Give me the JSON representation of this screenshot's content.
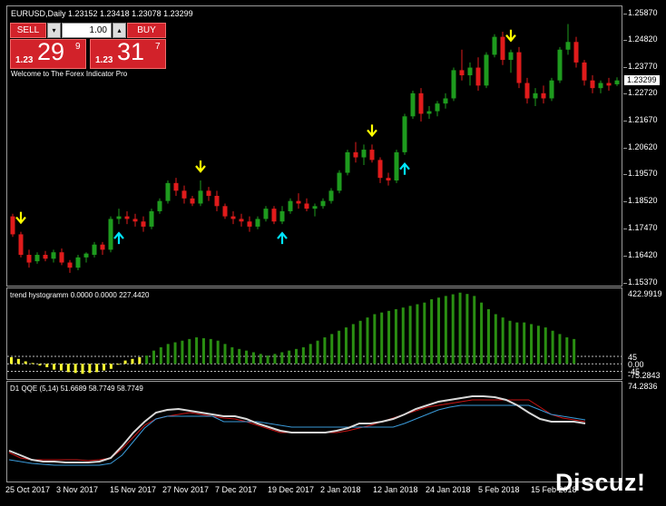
{
  "chart_header": {
    "symbol_line": "EURUSD,Daily  1.23152 1.23418 1.23078 1.23299",
    "welcome": "Welcome to The Forex Indicator Pro"
  },
  "trade_panel": {
    "sell_label": "SELL",
    "buy_label": "BUY",
    "lot_value": "1.00",
    "sell_prefix": "1.23",
    "sell_main": "29",
    "sell_sup": "9",
    "buy_prefix": "1.23",
    "buy_main": "31",
    "buy_sup": "7",
    "down_glyph": "▾",
    "up_glyph": "▴"
  },
  "price_scale": {
    "labels": [
      "1.25870",
      "1.24820",
      "1.23770",
      "1.22720",
      "1.21670",
      "1.20620",
      "1.19570",
      "1.18520",
      "1.17470",
      "1.16420",
      "1.15370"
    ],
    "current": "1.23299"
  },
  "histogram_pane": {
    "title": "trend hystogramm 0.0000 0.0000 227.4420",
    "scale_labels": [
      "422.9919",
      "45",
      "0.00",
      "-45",
      "-75.2843"
    ]
  },
  "qqe_pane": {
    "title": "D1  QQE (5,14) 51.6689 58.7749 58.7749",
    "scale_labels": [
      "74.2836"
    ]
  },
  "time_axis": {
    "labels": [
      "25 Oct 2017",
      "3 Nov 2017",
      "15 Nov 2017",
      "27 Nov 2017",
      "7 Dec 2017",
      "19 Dec 2017",
      "2 Jan 2018",
      "12 Jan 2018",
      "24 Jan 2018",
      "5 Feb 2018",
      "15 Feb 2018"
    ]
  },
  "watermark": "Discuz!",
  "colors": {
    "bull": "#1e9b1e",
    "bear": "#e01b1b",
    "sell_arrow": "#ffff00",
    "buy_arrow": "#00e5ff",
    "hist_up": "#2a8f12",
    "hist_neutral": "#ffff33",
    "qqe_fast": "#d9d9d9",
    "qqe_slow": "#3a9ad9",
    "qqe_signal": "#c81414"
  },
  "chart_data": [
    {
      "type": "candlestick",
      "title": "EURUSD,Daily",
      "ylim": [
        1.1537,
        1.2587
      ],
      "candles": [
        [
          1.18,
          1.181,
          1.172,
          1.173
        ],
        [
          1.173,
          1.174,
          1.164,
          1.165
        ],
        [
          1.165,
          1.167,
          1.16,
          1.162
        ],
        [
          1.1625,
          1.166,
          1.1615,
          1.165
        ],
        [
          1.165,
          1.1665,
          1.1625,
          1.1635
        ],
        [
          1.1635,
          1.167,
          1.162,
          1.166
        ],
        [
          1.166,
          1.1675,
          1.161,
          1.162
        ],
        [
          1.162,
          1.163,
          1.158,
          1.16
        ],
        [
          1.16,
          1.165,
          1.159,
          1.164
        ],
        [
          1.164,
          1.166,
          1.162,
          1.1655
        ],
        [
          1.165,
          1.17,
          1.164,
          1.169
        ],
        [
          1.169,
          1.17,
          1.165,
          1.167
        ],
        [
          1.167,
          1.18,
          1.166,
          1.179
        ],
        [
          1.179,
          1.183,
          1.177,
          1.18
        ],
        [
          1.18,
          1.182,
          1.177,
          1.179
        ],
        [
          1.179,
          1.181,
          1.176,
          1.178
        ],
        [
          1.178,
          1.18,
          1.174,
          1.176
        ],
        [
          1.176,
          1.183,
          1.175,
          1.182
        ],
        [
          1.182,
          1.187,
          1.181,
          1.186
        ],
        [
          1.186,
          1.194,
          1.185,
          1.193
        ],
        [
          1.193,
          1.195,
          1.188,
          1.19
        ],
        [
          1.19,
          1.192,
          1.185,
          1.187
        ],
        [
          1.187,
          1.188,
          1.184,
          1.185
        ],
        [
          1.185,
          1.194,
          1.184,
          1.19
        ],
        [
          1.19,
          1.1915,
          1.186,
          1.188
        ],
        [
          1.188,
          1.19,
          1.182,
          1.184
        ],
        [
          1.184,
          1.185,
          1.179,
          1.18
        ],
        [
          1.18,
          1.182,
          1.177,
          1.179
        ],
        [
          1.179,
          1.181,
          1.176,
          1.178
        ],
        [
          1.178,
          1.18,
          1.174,
          1.176
        ],
        [
          1.176,
          1.18,
          1.175,
          1.179
        ],
        [
          1.179,
          1.184,
          1.178,
          1.183
        ],
        [
          1.183,
          1.184,
          1.177,
          1.178
        ],
        [
          1.178,
          1.184,
          1.177,
          1.182
        ],
        [
          1.182,
          1.187,
          1.181,
          1.186
        ],
        [
          1.186,
          1.189,
          1.183,
          1.185
        ],
        [
          1.185,
          1.187,
          1.182,
          1.183
        ],
        [
          1.183,
          1.185,
          1.18,
          1.184
        ],
        [
          1.184,
          1.187,
          1.183,
          1.186
        ],
        [
          1.186,
          1.191,
          1.185,
          1.19
        ],
        [
          1.19,
          1.198,
          1.189,
          1.197
        ],
        [
          1.197,
          1.206,
          1.196,
          1.205
        ],
        [
          1.205,
          1.209,
          1.201,
          1.203
        ],
        [
          1.203,
          1.208,
          1.2,
          1.206
        ],
        [
          1.206,
          1.208,
          1.201,
          1.202
        ],
        [
          1.202,
          1.203,
          1.193,
          1.195
        ],
        [
          1.195,
          1.197,
          1.192,
          1.194
        ],
        [
          1.194,
          1.206,
          1.193,
          1.205
        ],
        [
          1.205,
          1.22,
          1.204,
          1.219
        ],
        [
          1.219,
          1.229,
          1.218,
          1.228
        ],
        [
          1.228,
          1.23,
          1.217,
          1.22
        ],
        [
          1.22,
          1.223,
          1.218,
          1.221
        ],
        [
          1.221,
          1.225,
          1.219,
          1.224
        ],
        [
          1.224,
          1.228,
          1.222,
          1.226
        ],
        [
          1.226,
          1.238,
          1.225,
          1.237
        ],
        [
          1.237,
          1.245,
          1.233,
          1.235
        ],
        [
          1.235,
          1.24,
          1.231,
          1.238
        ],
        [
          1.238,
          1.242,
          1.229,
          1.231
        ],
        [
          1.231,
          1.244,
          1.23,
          1.243
        ],
        [
          1.243,
          1.251,
          1.242,
          1.25
        ],
        [
          1.25,
          1.252,
          1.239,
          1.241
        ],
        [
          1.241,
          1.245,
          1.236,
          1.244
        ],
        [
          1.244,
          1.246,
          1.23,
          1.232
        ],
        [
          1.232,
          1.234,
          1.224,
          1.226
        ],
        [
          1.226,
          1.23,
          1.223,
          1.228
        ],
        [
          1.228,
          1.231,
          1.224,
          1.226
        ],
        [
          1.226,
          1.234,
          1.225,
          1.233
        ],
        [
          1.233,
          1.246,
          1.232,
          1.245
        ],
        [
          1.245,
          1.255,
          1.243,
          1.248
        ],
        [
          1.248,
          1.25,
          1.238,
          1.24
        ],
        [
          1.24,
          1.241,
          1.231,
          1.233
        ],
        [
          1.233,
          1.235,
          1.228,
          1.23
        ],
        [
          1.23,
          1.233,
          1.228,
          1.232
        ],
        [
          1.232,
          1.234,
          1.229,
          1.231
        ],
        [
          1.2315,
          1.2342,
          1.2308,
          1.233
        ]
      ],
      "signals": [
        {
          "i": 1,
          "dir": "sell"
        },
        {
          "i": 13,
          "dir": "buy"
        },
        {
          "i": 23,
          "dir": "sell"
        },
        {
          "i": 33,
          "dir": "buy"
        },
        {
          "i": 44,
          "dir": "sell"
        },
        {
          "i": 48,
          "dir": "buy"
        },
        {
          "i": 61,
          "dir": "sell"
        }
      ]
    },
    {
      "type": "bar",
      "title": "trend hystogramm",
      "ylim": [
        -75.2843,
        422.9919
      ],
      "levels": [
        45,
        0,
        -45
      ],
      "values": [
        40,
        30,
        15,
        5,
        -10,
        -20,
        -35,
        -40,
        -50,
        -55,
        -60,
        -55,
        -50,
        -40,
        -30,
        0,
        20,
        30,
        40,
        50,
        80,
        100,
        120,
        130,
        140,
        150,
        160,
        155,
        150,
        140,
        120,
        100,
        90,
        80,
        70,
        60,
        50,
        60,
        70,
        80,
        90,
        100,
        120,
        140,
        160,
        180,
        200,
        220,
        240,
        260,
        280,
        300,
        310,
        320,
        330,
        340,
        350,
        360,
        370,
        390,
        400,
        410,
        420,
        430,
        422,
        410,
        370,
        330,
        300,
        280,
        260,
        250,
        250,
        240,
        230,
        220,
        200,
        180,
        160,
        150
      ]
    },
    {
      "type": "line",
      "title": "QQE (5,14)",
      "ylim": [
        0,
        100
      ],
      "series": [
        {
          "values": [
            30,
            25,
            20,
            18,
            18,
            17,
            17,
            17,
            18,
            22,
            35,
            50,
            62,
            72,
            75,
            76,
            74,
            72,
            70,
            68,
            68,
            65,
            60,
            56,
            52,
            50,
            50,
            50,
            50,
            52,
            55,
            60,
            60,
            62,
            65,
            70,
            76,
            80,
            84,
            86,
            88,
            90,
            90,
            89,
            86,
            80,
            72,
            65,
            62,
            62,
            62,
            60
          ]
        },
        {
          "values": [
            20,
            18,
            16,
            15,
            14,
            14,
            14,
            14,
            14,
            16,
            25,
            40,
            55,
            65,
            68,
            68,
            68,
            68,
            68,
            62,
            62,
            62,
            62,
            60,
            58,
            56,
            56,
            56,
            56,
            56,
            56,
            56,
            56,
            56,
            56,
            60,
            65,
            70,
            75,
            78,
            80,
            80,
            80,
            80,
            80,
            80,
            80,
            75,
            70,
            68,
            66,
            64
          ]
        },
        {
          "values": [
            28,
            22,
            20,
            20,
            20,
            20,
            20,
            19,
            20,
            22,
            32,
            45,
            58,
            65,
            68,
            70,
            72,
            70,
            68,
            66,
            65,
            62,
            58,
            54,
            50,
            50,
            50,
            50,
            50,
            50,
            52,
            55,
            58,
            62,
            66,
            70,
            74,
            78,
            80,
            82,
            84,
            86,
            86,
            86,
            86,
            86,
            86,
            78,
            70,
            66,
            64,
            62
          ]
        }
      ]
    }
  ]
}
